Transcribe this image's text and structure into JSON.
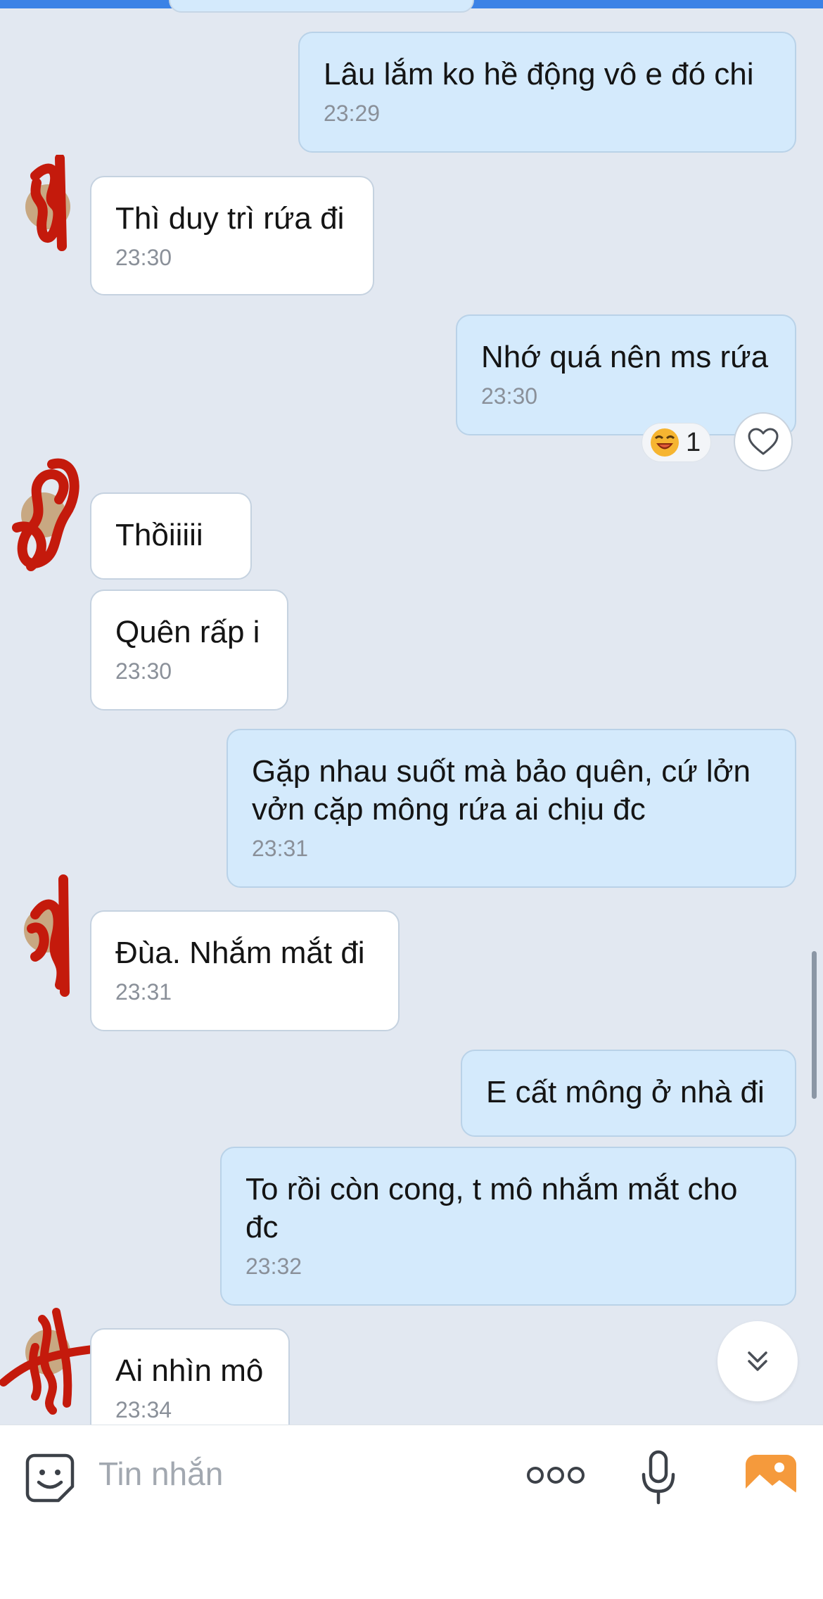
{
  "colors": {
    "accent": "#3b82e6",
    "outgoing_bubble": "#d4eafc",
    "incoming_bubble": "#ffffff",
    "background": "#e2e8f1"
  },
  "messages": [
    {
      "direction": "out",
      "text": "Lâu lắm ko hề động vô e đó chi",
      "time": "23:29"
    },
    {
      "direction": "in",
      "text": "Thì duy trì rứa đi",
      "time": "23:30"
    },
    {
      "direction": "out",
      "text": "Nhớ quá nên ms rứa",
      "time": "23:30",
      "reaction": {
        "icon": "laughing-emoji-icon",
        "count": "1"
      }
    },
    {
      "direction": "in",
      "text": "Thồiiiii",
      "time": ""
    },
    {
      "direction": "in",
      "text": "Quên rấp i",
      "time": "23:30"
    },
    {
      "direction": "out",
      "text": "Gặp nhau suốt mà bảo quên, cứ lởn vởn cặp mông rứa ai chịu đc",
      "time": "23:31"
    },
    {
      "direction": "in",
      "text": "Đùa. Nhắm mắt đi",
      "time": "23:31"
    },
    {
      "direction": "out",
      "text": "E cất mông ở nhà đi",
      "time": ""
    },
    {
      "direction": "out",
      "text": "To rồi còn cong, t mô nhắm mắt cho đc",
      "time": "23:32"
    },
    {
      "direction": "in",
      "text": "Ai nhìn mô",
      "time": "23:34"
    }
  ],
  "composer": {
    "placeholder": "Tin nhắn",
    "icons": [
      "sticker-icon",
      "more-icon",
      "microphone-icon",
      "gallery-icon"
    ]
  }
}
